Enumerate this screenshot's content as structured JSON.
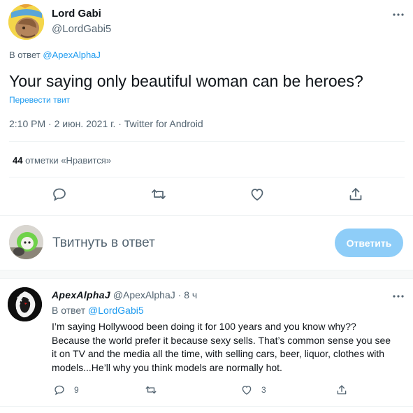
{
  "main_tweet": {
    "author_name": "Lord Gabi",
    "author_handle": "@LordGabi5",
    "replying_prefix": "В ответ",
    "replying_to": "@ApexAlphaJ",
    "text": "Your saying only beautiful woman can be heroes?",
    "translate_label": "Перевести твит",
    "timestamp": "2:10 PM · 2 июн. 2021 г. · Twitter for Android",
    "likes_count": "44",
    "likes_label": "отметки «Нравится»"
  },
  "actions": {
    "reply_icon": "speech-bubble-icon",
    "retweet_icon": "retweet-arrows-icon",
    "like_icon": "heart-icon",
    "share_icon": "share-upload-icon"
  },
  "composer": {
    "placeholder": "Твитнуть в ответ",
    "reply_button_label": "Ответить"
  },
  "reply_tweet": {
    "author_name": "ApexAlphaJ",
    "author_handle": "@ApexAlphaJ",
    "time_ago": "· 8 ч",
    "replying_prefix": "В ответ",
    "replying_to": "@LordGabi5",
    "text": "I’m saying Hollywood been doing it for 100 years and you know why?? Because the world prefer it because sexy sells. That’s common sense you see it on TV and the media all the time, with selling cars, beer, liquor, clothes with models...He’ll why you think models are normally hot.",
    "reply_count": "9",
    "like_count": "3"
  },
  "colors": {
    "accent": "#1d9bf0",
    "muted_text": "#536471",
    "reply_button_disabled": "#8ecdf8"
  }
}
